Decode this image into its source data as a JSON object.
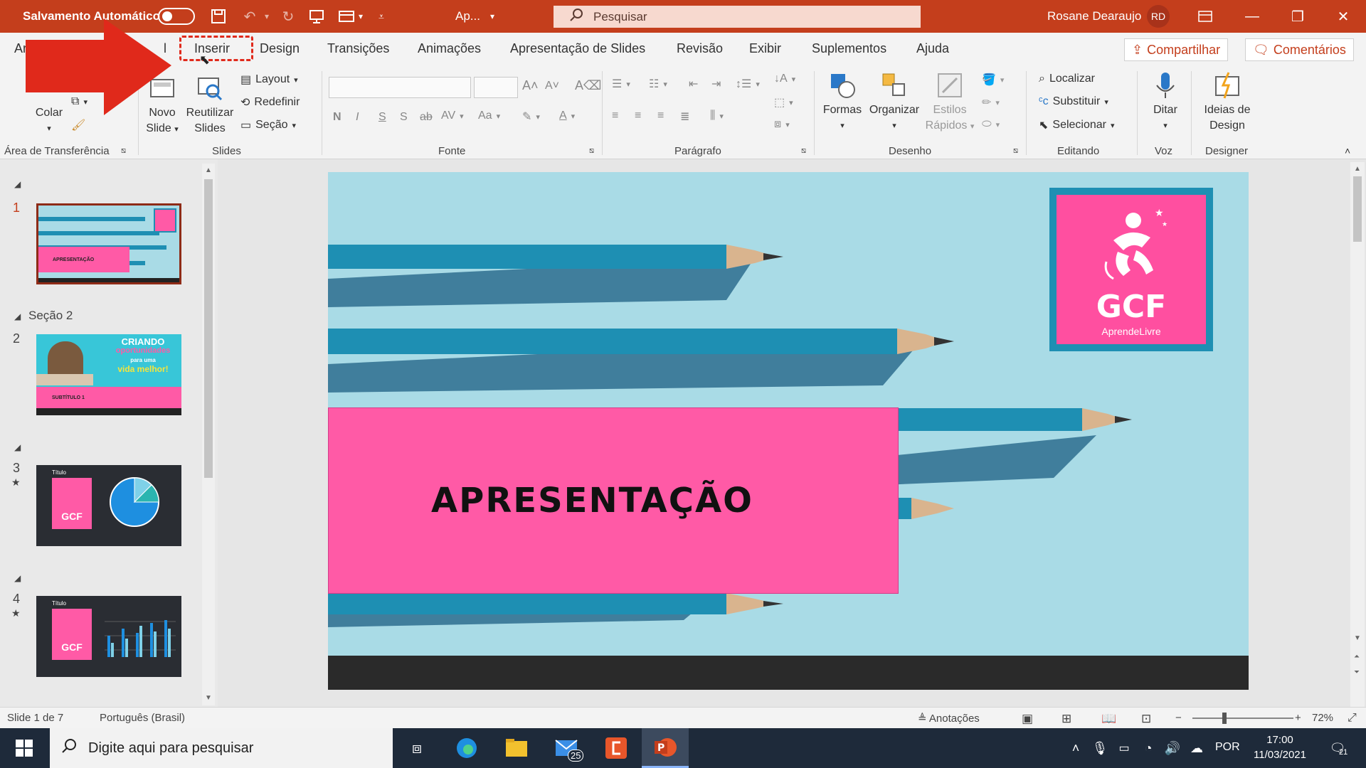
{
  "window": {
    "autosave_label": "Salvamento Automático",
    "doc_title": "Ap...",
    "search_placeholder": "Pesquisar",
    "user_name": "Rosane Dearaujo",
    "user_initials": "RD"
  },
  "tabs": [
    "Arquivo",
    "Página Inicial",
    "Inserir",
    "Design",
    "Transições",
    "Animações",
    "Apresentação de Slides",
    "Revisão",
    "Exibir",
    "Suplementos",
    "Ajuda"
  ],
  "tabs_visible": {
    "arquivo": "Ar",
    "pagina_inicial": "l",
    "inserir": "Inserir",
    "design": "Design",
    "transicoes": "Transições",
    "animacoes": "Animações",
    "apresentacao": "Apresentação de Slides",
    "revisao": "Revisão",
    "exibir": "Exibir",
    "suplementos": "Suplementos",
    "ajuda": "Ajuda"
  },
  "share": {
    "compartilhar": "Compartilhar",
    "comentarios": "Comentários"
  },
  "ribbon": {
    "clipboard": {
      "colar": "Colar",
      "label": "Área de Transferência"
    },
    "slides": {
      "novo_slide": [
        "Novo",
        "Slide"
      ],
      "reutilizar": [
        "Reutilizar",
        "Slides"
      ],
      "layout": "Layout",
      "redefinir": "Redefinir",
      "secao": "Seção",
      "label": "Slides"
    },
    "font": {
      "label": "Fonte",
      "bold": "N",
      "italic": "I",
      "underline": "S",
      "shadow": "S"
    },
    "paragraph": {
      "label": "Parágrafo"
    },
    "drawing": {
      "formas": "Formas",
      "organizar": "Organizar",
      "estilos": [
        "Estilos",
        "Rápidos"
      ],
      "label": "Desenho"
    },
    "editing": {
      "localizar": "Localizar",
      "substituir": "Substituir",
      "selecionar": "Selecionar",
      "label": "Editando"
    },
    "voice": {
      "ditar": "Ditar",
      "label": "Voz"
    },
    "designer": {
      "ideias": [
        "Ideias de",
        "Design"
      ],
      "label": "Designer"
    }
  },
  "thumbnails": {
    "section2": "Seção 2",
    "slides": [
      {
        "num": "1",
        "title": "APRESENTAÇÃO"
      },
      {
        "num": "2",
        "heading1": "CRIANDO",
        "heading2": "oportunidades",
        "heading3": "para uma",
        "heading4": "vida",
        "heading5": "melhor!",
        "subtitle": "SUBTÍTULO 1"
      },
      {
        "num": "3",
        "star": "★",
        "title": "Título",
        "logo": "GCF"
      },
      {
        "num": "4",
        "star": "★",
        "title": "Título",
        "logo": "GCF"
      }
    ]
  },
  "slide": {
    "title": "APRESENTAÇÃO",
    "logo_main": "GCF",
    "logo_sub": "AprendeLivre"
  },
  "status": {
    "slide_info": "Slide 1 de 7",
    "language": "Português (Brasil)",
    "notes": "Anotações",
    "zoom": "72%"
  },
  "taskbar": {
    "search_placeholder": "Digite aqui para pesquisar",
    "mail_badge": "25",
    "lang": "POR",
    "time": "17:00",
    "date": "11/03/2021",
    "notif_count": "21"
  },
  "colors": {
    "accent": "#c43e1c",
    "slide_bg": "#a9dbe6",
    "pink": "#ff5aa6",
    "pencil": "#1e8fb3",
    "arrow": "#e0291b"
  }
}
